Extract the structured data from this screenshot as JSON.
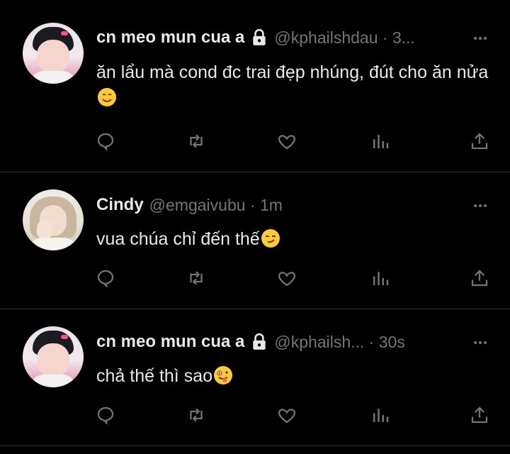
{
  "tweets": [
    {
      "name": "cn meo mun cua a",
      "handle": "@kphailshdau · 3...",
      "text": "ăn lẩu mà cond đc trai đẹp nhúng, đút cho ăn nửa",
      "text_line2": "",
      "emoji": "smiling-face-icon",
      "locked": true,
      "avatar": "boy"
    },
    {
      "name": "Cindy",
      "handle": "@emgaivubu · 1m",
      "text": "vua chúa chỉ đến thế",
      "emoji": "smirking-face-icon",
      "locked": false,
      "avatar": "girl"
    },
    {
      "name": "cn meo mun cua a",
      "handle": "@kphailsh... · 30s",
      "text": "chả thế thì sao",
      "emoji": "zany-face-icon",
      "locked": true,
      "avatar": "boy"
    }
  ],
  "colors": {
    "background": "#000000",
    "text": "#e7e9ea",
    "muted": "#71767b",
    "divider": "#2f3336"
  }
}
